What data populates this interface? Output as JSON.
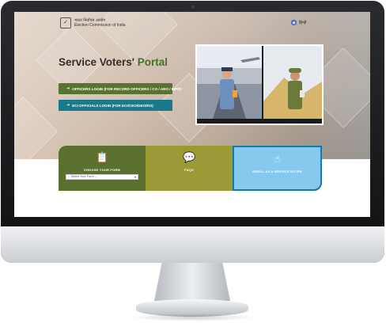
{
  "header": {
    "org_name_hindi": "भारत निर्वाचन आयोग",
    "org_name_english": "Election Commission of India",
    "language_toggle": "हिन्दी",
    "emblem_icon": "eci-emblem-icon"
  },
  "hero": {
    "title_main": "Service Voters'",
    "title_accent": "Portal",
    "officers_login": "OFFICERS LOGIN (FOR RECORD OFFICERS / CO / ARO / EIPO)",
    "eci_login": "ECI OFFICIALS LOGIN (FOR ECI/CEO/DEO/RO)"
  },
  "cards": {
    "form": {
      "label": "CHOOSE YOUR FORM",
      "select_value": "-- Select Your Form --"
    },
    "faqs": {
      "label": "FAQS"
    },
    "enrol": {
      "label": "ENROL AS A SERVICE VOTER"
    }
  },
  "colors": {
    "title_accent": "#4b6d2b",
    "officers_button": "#5b7330",
    "eci_button": "#197a8c",
    "card_form": "#5b6f2f",
    "card_faqs": "#9b9a37",
    "card_enrol": "#86c9ee"
  },
  "icons": {
    "login": "login-arrow-icon",
    "form": "clipboard-icon",
    "faqs": "chat-bubble-icon",
    "enrol": "hand-pointer-icon",
    "language": "globe-icon"
  }
}
